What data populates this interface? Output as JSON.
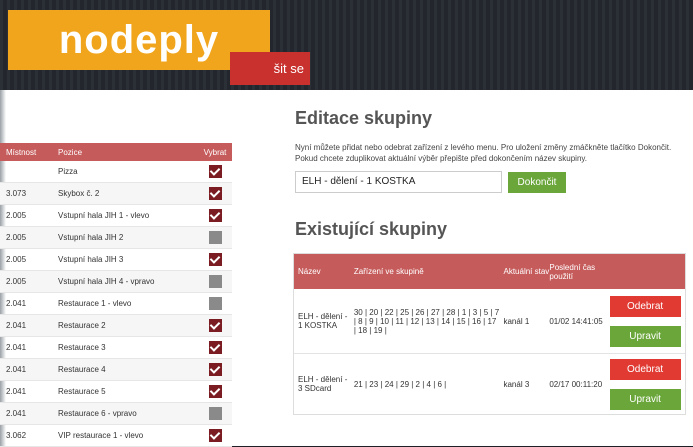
{
  "header": {
    "logo_text": "nodeply",
    "top_button_label": "šit se"
  },
  "edit_group": {
    "title": "Editace skupiny",
    "description": "Nyní můžete přidat nebo odebrat zařízení z levého menu. Pro uložení změny zmáčkněte tlačítko Dokončit. Pokud chcete zduplikovat aktuální výběr přepište před dokončením název skupiny.",
    "input_value": "ELH - dělení - 1 KOSTKA",
    "done_label": "Dokončit"
  },
  "existing_groups": {
    "title": "Existující skupiny",
    "headers": [
      "Název",
      "Zařízení ve skupině",
      "Aktuální stav",
      "Poslední čas použití",
      ""
    ],
    "rows": [
      {
        "name": "ELH - dělení - 1 KOSTKA",
        "devices": "30 | 20 | 22 | 25 | 26 | 27 | 28 | 1 | 3 | 5 | 7 | 8 | 9 | 10 | 11 | 12 | 13 | 14 | 15 | 16 | 17 | 18 | 19 |",
        "state": "kanál 1",
        "last_used": "01/02 14:41:05",
        "remove": "Odebrat",
        "edit": "Upravit"
      },
      {
        "name": "ELH - dělení - 3 SDcard",
        "devices": "21 | 23 | 24 | 29 | 2 | 4 | 6 |",
        "state": "kanál 3",
        "last_used": "02/17 00:11:20",
        "remove": "Odebrat",
        "edit": "Upravit"
      }
    ]
  },
  "device_table": {
    "headers": [
      "Místnost",
      "Pozice",
      "Vybrat"
    ],
    "rows": [
      {
        "room": "",
        "position": "Pizza",
        "selected": true
      },
      {
        "room": "3.073",
        "position": "Skybox č. 2",
        "selected": true
      },
      {
        "room": "2.005",
        "position": "Vstupní hala JIH 1 - vlevo",
        "selected": true
      },
      {
        "room": "2.005",
        "position": "Vstupní hala JIH 2",
        "selected": false
      },
      {
        "room": "2.005",
        "position": "Vstupní hala JIH 3",
        "selected": true
      },
      {
        "room": "2.005",
        "position": "Vstupní hala JIH 4 - vpravo",
        "selected": false
      },
      {
        "room": "2.041",
        "position": "Restaurace 1 - vlevo",
        "selected": false
      },
      {
        "room": "2.041",
        "position": "Restaurace 2",
        "selected": true
      },
      {
        "room": "2.041",
        "position": "Restaurace 3",
        "selected": true
      },
      {
        "room": "2.041",
        "position": "Restaurace 4",
        "selected": true
      },
      {
        "room": "2.041",
        "position": "Restaurace 5",
        "selected": true
      },
      {
        "room": "2.041",
        "position": "Restaurace 6 - vpravo",
        "selected": false
      },
      {
        "room": "3.062",
        "position": "VIP restaurace 1 - vlevo",
        "selected": true
      }
    ]
  }
}
